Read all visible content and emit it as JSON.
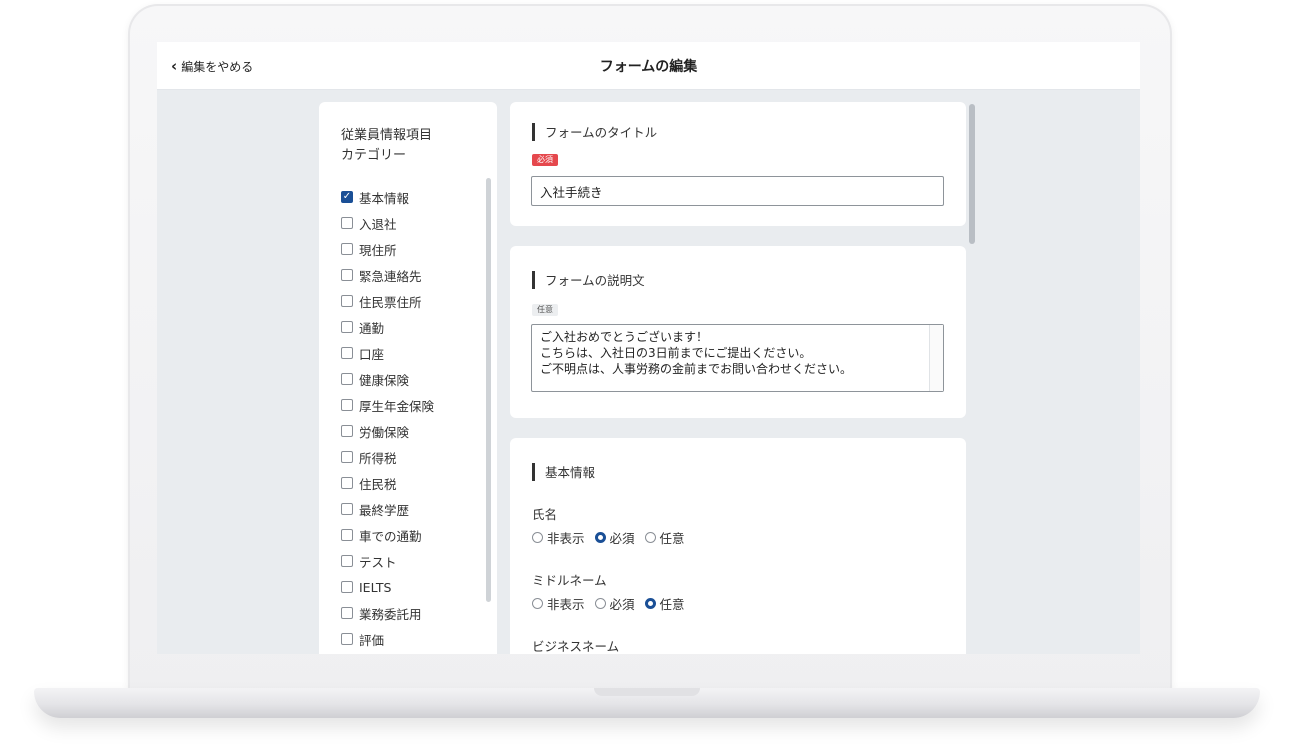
{
  "topbar": {
    "back_label": "編集をやめる",
    "title": "フォームの編集"
  },
  "sidebar": {
    "title_line1": "従業員情報項目",
    "title_line2": "カテゴリー",
    "items": [
      {
        "label": "基本情報",
        "checked": true
      },
      {
        "label": "入退社",
        "checked": false
      },
      {
        "label": "現住所",
        "checked": false
      },
      {
        "label": "緊急連絡先",
        "checked": false
      },
      {
        "label": "住民票住所",
        "checked": false
      },
      {
        "label": "通勤",
        "checked": false
      },
      {
        "label": "口座",
        "checked": false
      },
      {
        "label": "健康保険",
        "checked": false
      },
      {
        "label": "厚生年金保険",
        "checked": false
      },
      {
        "label": "労働保険",
        "checked": false
      },
      {
        "label": "所得税",
        "checked": false
      },
      {
        "label": "住民税",
        "checked": false
      },
      {
        "label": "最終学歴",
        "checked": false
      },
      {
        "label": "車での通勤",
        "checked": false
      },
      {
        "label": "テスト",
        "checked": false
      },
      {
        "label": "IELTS",
        "checked": false
      },
      {
        "label": "業務委託用",
        "checked": false
      },
      {
        "label": "評価",
        "checked": false
      }
    ]
  },
  "form_title": {
    "heading": "フォームのタイトル",
    "badge": "必須",
    "value": "入社手続き"
  },
  "form_description": {
    "heading": "フォームの説明文",
    "badge": "任意",
    "lines": [
      "ご入社おめでとうございます！",
      "こちらは、入社日の3日前までにご提出ください。",
      "ご不明点は、人事労務の金前までお問い合わせください。"
    ]
  },
  "basic_info": {
    "heading": "基本情報",
    "options": [
      "非表示",
      "必須",
      "任意"
    ],
    "fields": [
      {
        "label": "氏名",
        "selected": "必須"
      },
      {
        "label": "ミドルネーム",
        "selected": "任意"
      },
      {
        "label": "ビジネスネーム",
        "selected": ""
      }
    ]
  },
  "colors": {
    "accent": "#1a4f96",
    "required_badge": "#e5484d",
    "background": "#e9ecef"
  }
}
